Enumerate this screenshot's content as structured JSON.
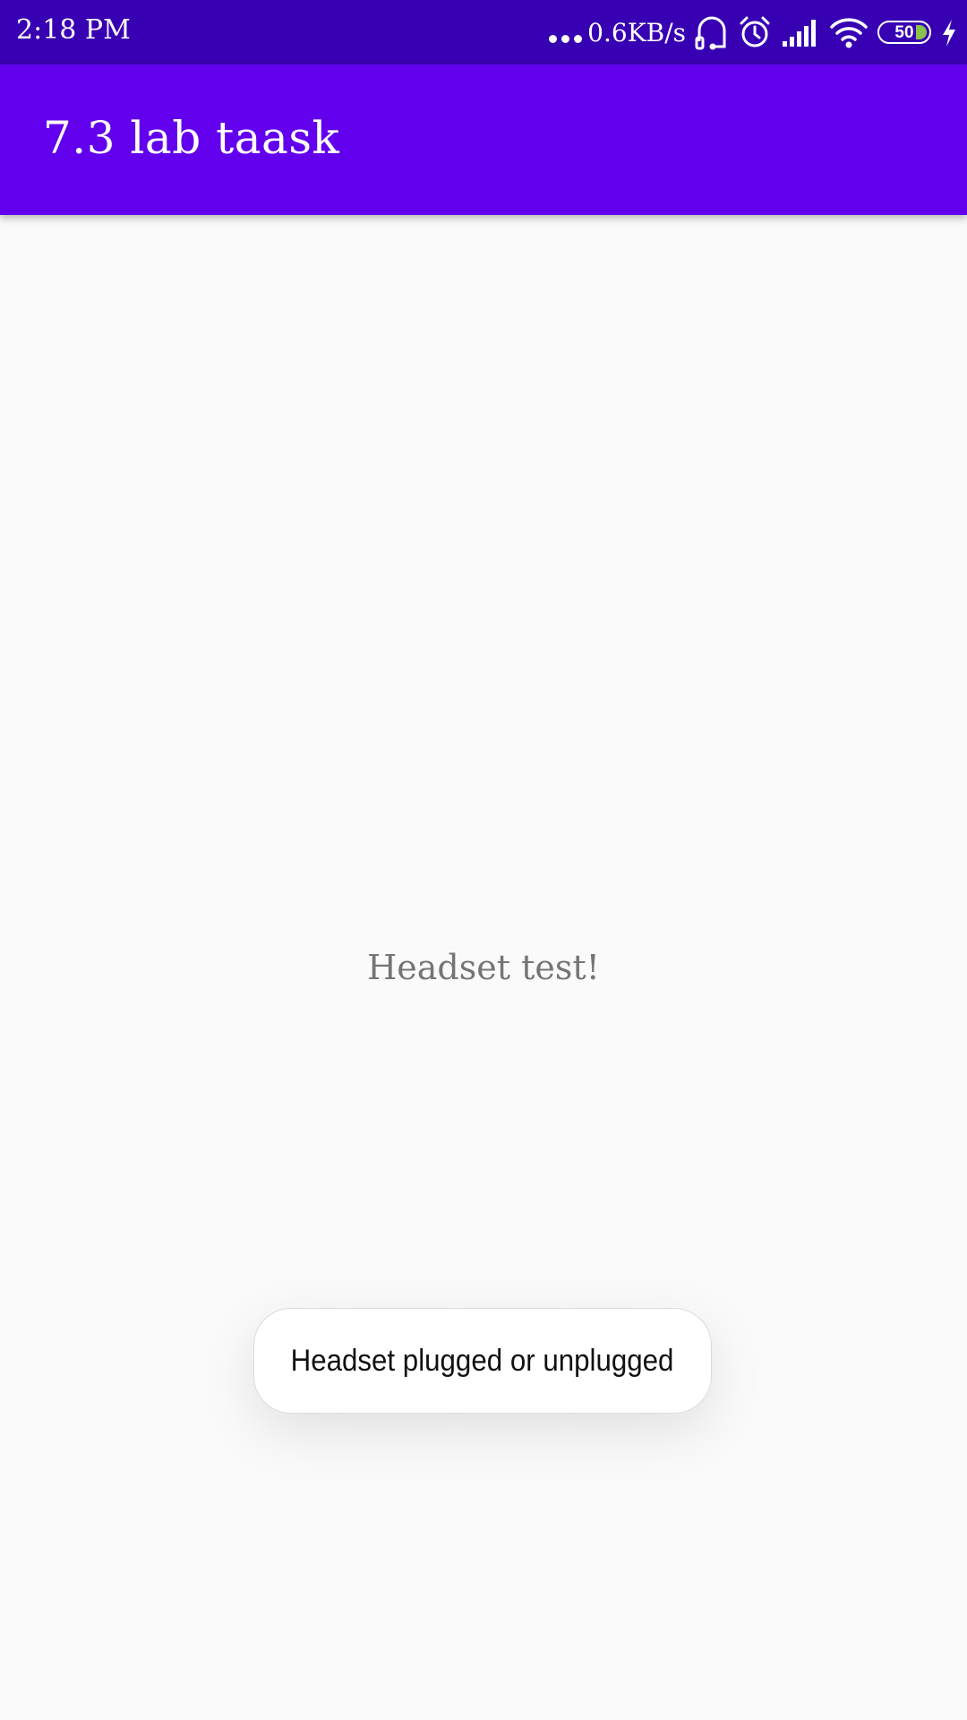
{
  "status_bar": {
    "time": "2:18 PM",
    "network_speed": "0.6KB/s",
    "battery_level": "50",
    "icons": [
      "more-dots-icon",
      "headset-icon",
      "alarm-icon",
      "signal-icon",
      "wifi-icon",
      "battery-icon",
      "charging-icon"
    ],
    "battery_fill_color": "#8bc34a"
  },
  "app_bar": {
    "title": "7.3 lab taask",
    "color": "#6200ee"
  },
  "main": {
    "text": "Headset test!"
  },
  "toast": {
    "message": "Headset plugged or unplugged"
  },
  "colors": {
    "status_bar": "#3700b3",
    "primary": "#6200ee",
    "background": "#fafafa",
    "body_text": "#757575"
  }
}
